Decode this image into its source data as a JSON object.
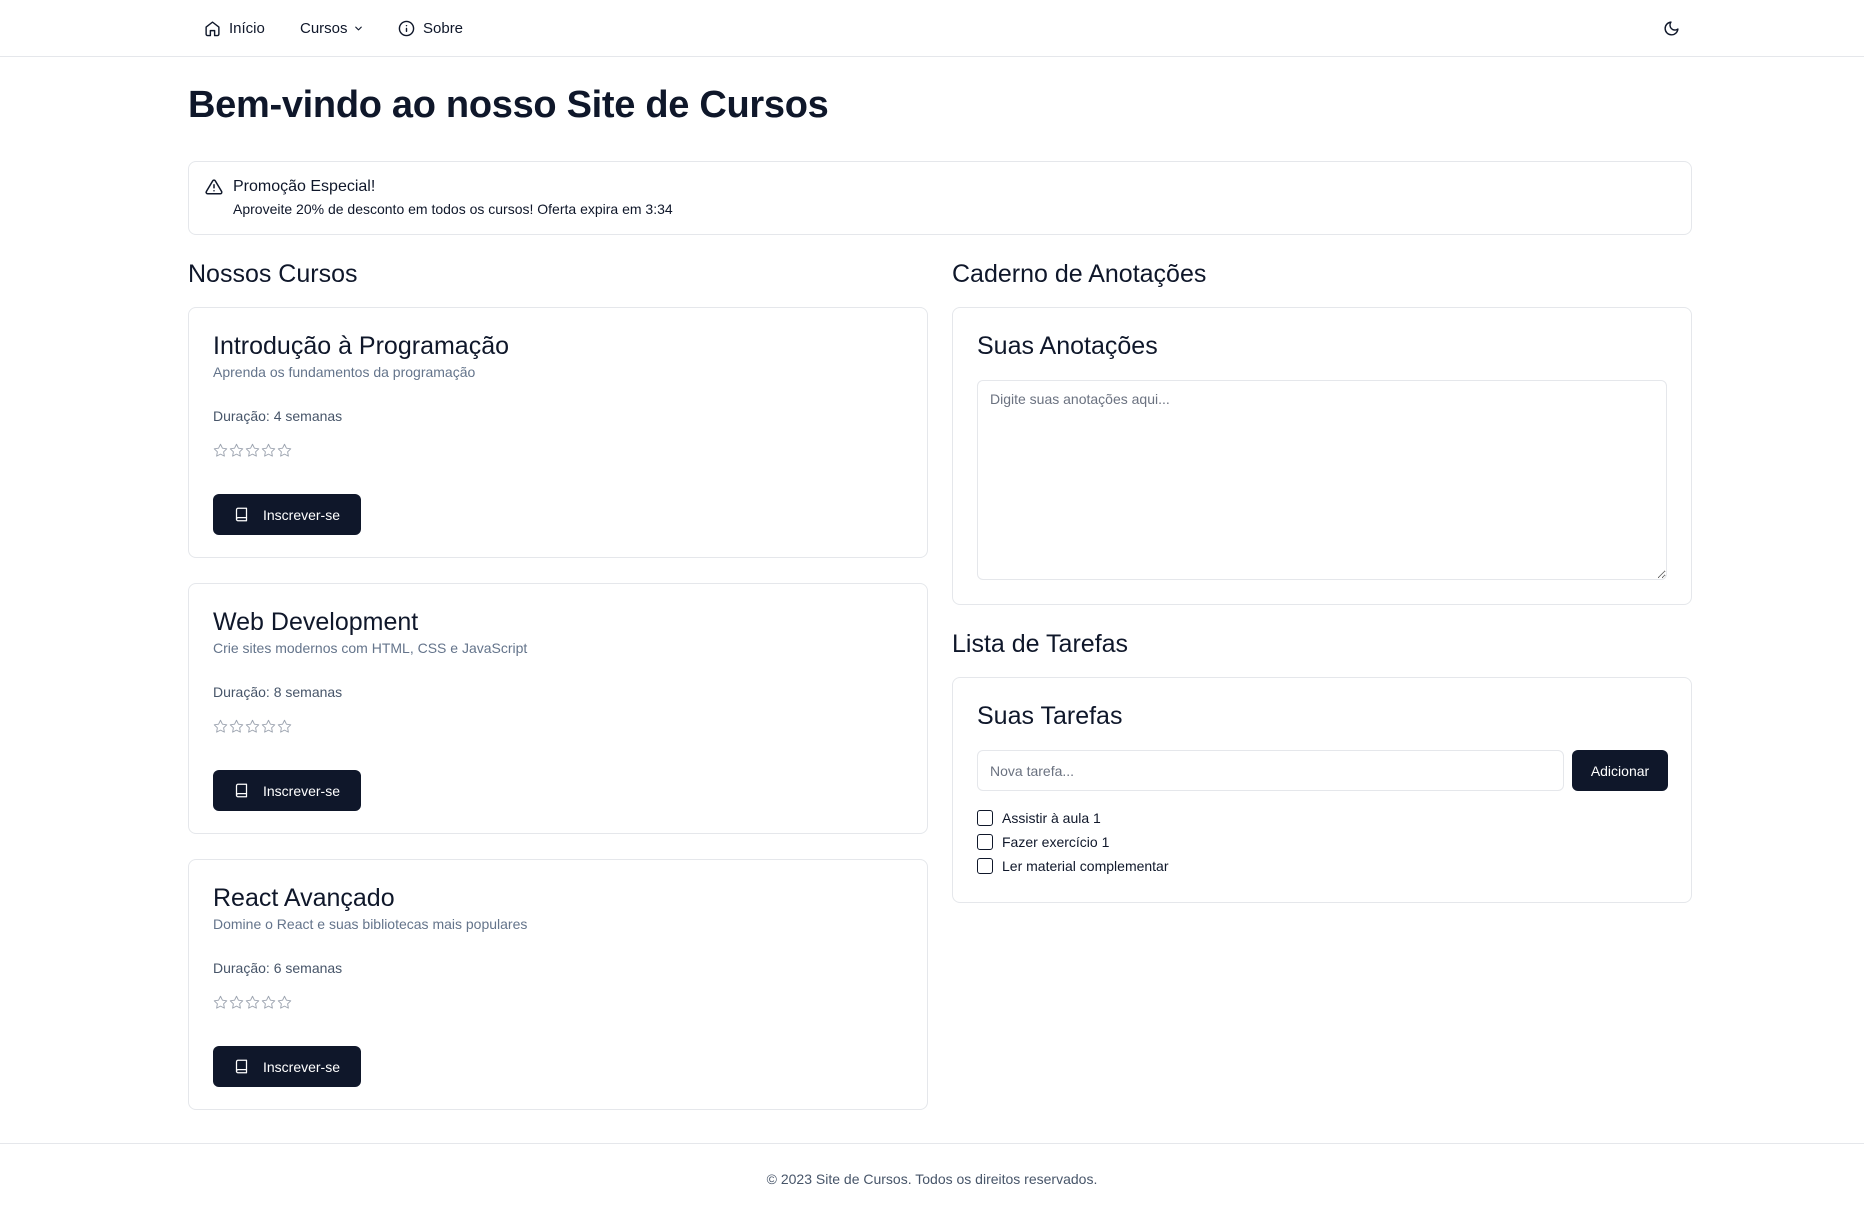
{
  "nav": {
    "items": [
      {
        "label": "Início",
        "icon": "home-icon"
      },
      {
        "label": "Cursos",
        "icon": "chevron-down-icon"
      },
      {
        "label": "Sobre",
        "icon": "info-icon"
      }
    ],
    "theme_icon": "moon-icon"
  },
  "header": {
    "title": "Bem-vindo ao nosso Site de Cursos"
  },
  "alert": {
    "icon": "warning-triangle-icon",
    "title": "Promoção Especial!",
    "text": "Aproveite 20% de desconto em todos os cursos! Oferta expira em 3:34"
  },
  "courses": {
    "heading": "Nossos Cursos",
    "items": [
      {
        "title": "Introdução à Programação",
        "description": "Aprenda os fundamentos da programação",
        "duration": "Duração: 4 semanas",
        "rating": 0,
        "max_rating": 5,
        "button_label": "Inscrever-se"
      },
      {
        "title": "Web Development",
        "description": "Crie sites modernos com HTML, CSS e JavaScript",
        "duration": "Duração: 8 semanas",
        "rating": 0,
        "max_rating": 5,
        "button_label": "Inscrever-se"
      },
      {
        "title": "React Avançado",
        "description": "Domine o React e suas bibliotecas mais populares",
        "duration": "Duração: 6 semanas",
        "rating": 0,
        "max_rating": 5,
        "button_label": "Inscrever-se"
      }
    ]
  },
  "notes": {
    "heading": "Caderno de Anotações",
    "card_title": "Suas Anotações",
    "placeholder": "Digite suas anotações aqui...",
    "value": ""
  },
  "tasks": {
    "heading": "Lista de Tarefas",
    "card_title": "Suas Tarefas",
    "input_placeholder": "Nova tarefa...",
    "input_value": "",
    "add_label": "Adicionar",
    "items": [
      {
        "label": "Assistir à aula 1",
        "checked": false
      },
      {
        "label": "Fazer exercício 1",
        "checked": false
      },
      {
        "label": "Ler material complementar",
        "checked": false
      }
    ]
  },
  "footer": {
    "text": "© 2023 Site de Cursos. Todos os direitos reservados."
  },
  "colors": {
    "primary": "#0f172a",
    "border": "#e5e7eb",
    "muted": "#64748b"
  }
}
